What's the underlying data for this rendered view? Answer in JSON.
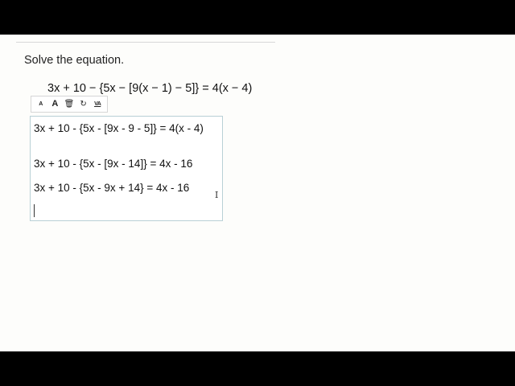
{
  "question": {
    "prompt": "Solve the equation.",
    "equation": "3x + 10 − {5x − [9(x − 1) − 5]} = 4(x − 4)"
  },
  "toolbar": {
    "items": [
      {
        "name": "decrease-font-size",
        "label": "A"
      },
      {
        "name": "increase-font-size",
        "label": "A"
      },
      {
        "name": "trash-icon",
        "label": "🗑"
      },
      {
        "name": "refresh-icon",
        "label": "↻"
      },
      {
        "name": "text-format-icon",
        "label": "VA"
      }
    ]
  },
  "editor": {
    "lines": [
      "3x + 10 - {5x - [9x - 9 - 5]} = 4(x - 4)",
      "3x + 10 - {5x - [9x - 14]} = 4x - 16",
      "3x + 10 - {5x - 9x + 14} = 4x - 16"
    ]
  },
  "cursor": {
    "glyph": "I"
  }
}
